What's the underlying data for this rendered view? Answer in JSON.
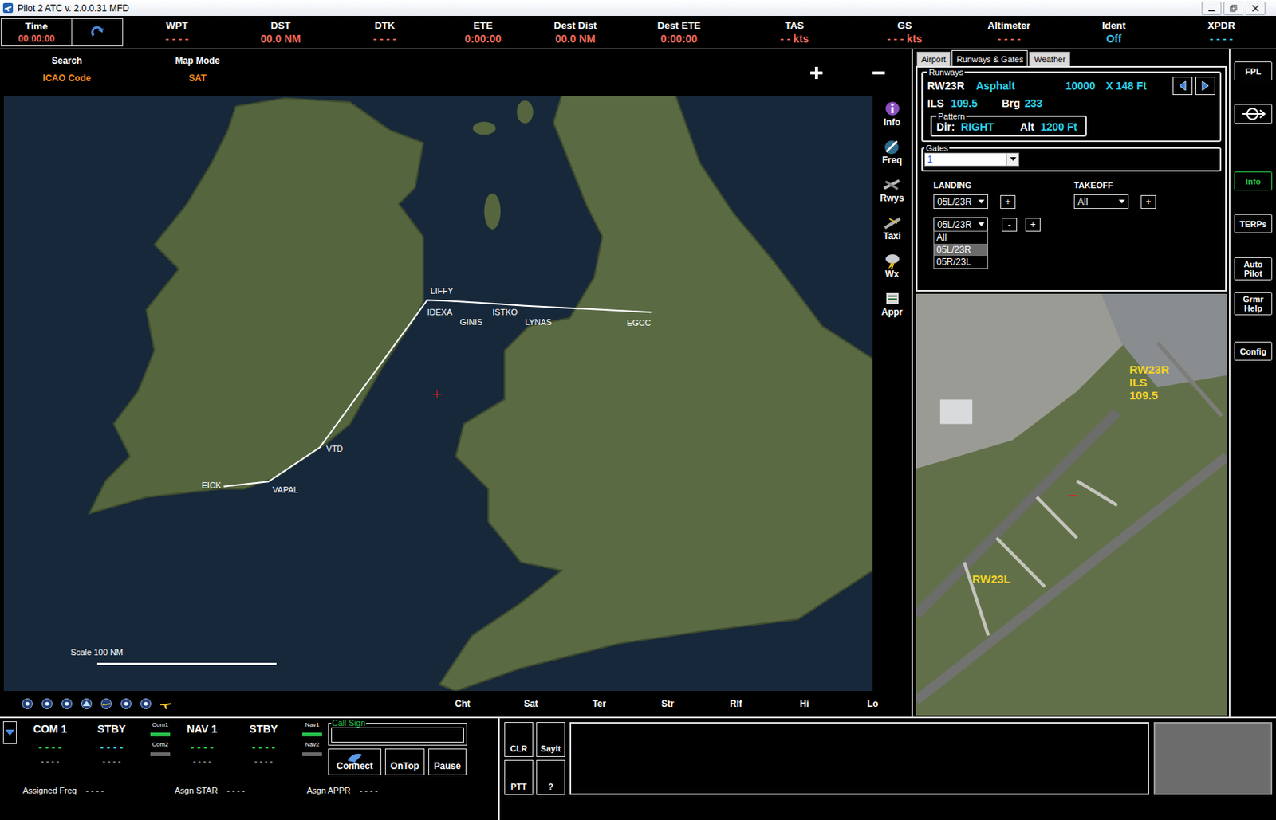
{
  "window": {
    "title": "Pilot 2 ATC v. 2.0.0.31 MFD"
  },
  "time": {
    "label": "Time",
    "value": "00:00:00"
  },
  "readouts": [
    {
      "label": "WPT",
      "value": "- - - -",
      "color": "#f26b5b"
    },
    {
      "label": "DST",
      "value": "00.0 NM",
      "color": "#f26b5b"
    },
    {
      "label": "DTK",
      "value": "- - - -",
      "color": "#f26b5b"
    },
    {
      "label": "ETE",
      "value": "0:00:00",
      "color": "#f26b5b"
    },
    {
      "label": "Dest Dist",
      "value": "00.0 NM",
      "color": "#f26b5b"
    },
    {
      "label": "Dest ETE",
      "value": "0:00:00",
      "color": "#f26b5b"
    },
    {
      "label": "TAS",
      "value": "- - kts",
      "color": "#f26b5b"
    },
    {
      "label": "GS",
      "value": "- - - kts",
      "color": "#f26b5b"
    },
    {
      "label": "Altimeter",
      "value": "- - - -",
      "color": "#f26b5b"
    },
    {
      "label": "Ident",
      "value": "Off",
      "color": "#3cc4e8"
    },
    {
      "label": "XPDR",
      "value": "- - - -",
      "color": "#3cc4e8"
    }
  ],
  "map": {
    "search": {
      "label": "Search",
      "value": "ICAO Code"
    },
    "mode": {
      "label": "Map Mode",
      "value": "SAT"
    },
    "tools": [
      "Info",
      "Freq",
      "Rwys",
      "Taxi",
      "Wx",
      "Appr"
    ],
    "route": [
      "EICK",
      "VAPAL",
      "VTD",
      "LIFFY",
      "IDEXA",
      "GINIS",
      "ISTKO",
      "LYNAS",
      "EGCC"
    ],
    "scale": "Scale 100 NM",
    "layers": [
      "Cht",
      "Sat",
      "Ter",
      "Str",
      "Rlf",
      "Hi",
      "Lo"
    ]
  },
  "airport_panel": {
    "tabs": [
      {
        "label": "Airport",
        "selected": false
      },
      {
        "label": "Runways & Gates",
        "selected": true
      },
      {
        "label": "Weather",
        "selected": false
      }
    ],
    "runways": {
      "legend": "Runways",
      "name": "RW23R",
      "surface": "Asphalt",
      "length": "10000",
      "width": "X 148 Ft",
      "ils_label": "ILS",
      "ils": "109.5",
      "brg_label": "Brg",
      "brg": "233",
      "pattern": {
        "legend": "Pattern",
        "dir_label": "Dir:",
        "dir": "RIGHT",
        "alt_label": "Alt",
        "alt": "1200 Ft"
      }
    },
    "gates": {
      "legend": "Gates",
      "value": "1"
    },
    "landing": {
      "label": "LANDING",
      "selects": [
        {
          "value": "05L/23R",
          "open": false,
          "options": []
        },
        {
          "value": "05L/23R",
          "open": true,
          "options": [
            {
              "label": "All",
              "selected": false
            },
            {
              "label": "05L/23R",
              "selected": true
            },
            {
              "label": "05R/23L",
              "selected": false
            }
          ]
        }
      ],
      "buttons": [
        [
          "+"
        ],
        [
          "-",
          "+"
        ]
      ]
    },
    "takeoff": {
      "label": "TAKEOFF",
      "value": "All",
      "button": "+"
    },
    "photo_labels": [
      {
        "lines": [
          "RW23R",
          "ILS",
          "109.5"
        ]
      },
      {
        "lines": [
          "RW23L"
        ]
      }
    ]
  },
  "side_buttons": [
    {
      "label": "FPL",
      "kind": "text",
      "selected": false
    },
    {
      "kind": "icon",
      "selected": false
    },
    {
      "label": "Info",
      "kind": "text",
      "selected": true
    },
    {
      "label": "TERPs",
      "kind": "text",
      "selected": false
    },
    {
      "label": "Auto Pilot",
      "kind": "text",
      "selected": false
    },
    {
      "label": "Grmr Help",
      "kind": "text",
      "selected": false
    },
    {
      "label": "Config",
      "kind": "text",
      "selected": false
    }
  ],
  "radio": {
    "groups": [
      {
        "radios": [
          {
            "label": "COM 1",
            "value": "- - - -",
            "sub": "- - - -",
            "color": "#2ecc40"
          },
          {
            "label": "STBY",
            "value": "- - - -",
            "sub": "- - - -",
            "color": "#3cc4e8"
          }
        ],
        "indicators": [
          {
            "label": "Com1",
            "on": true
          },
          {
            "label": "Com2",
            "on": false
          }
        ]
      },
      {
        "radios": [
          {
            "label": "NAV 1",
            "value": "- - - -",
            "sub": "- - - -",
            "color": "#2ecc40"
          },
          {
            "label": "STBY",
            "value": "- - - -",
            "sub": "- - - -",
            "color": "#2ecc40"
          }
        ],
        "indicators": [
          {
            "label": "Nav1",
            "on": true
          },
          {
            "label": "Nav2",
            "on": false
          }
        ]
      }
    ],
    "call_sign": {
      "legend": "Call Sign",
      "value": ""
    },
    "buttons": [
      "Connect",
      "OnTop",
      "Pause"
    ],
    "assigned": [
      {
        "label": "Assigned Freq",
        "value": "- - - -"
      },
      {
        "label": "Asgn STAR",
        "value": "- - - -"
      },
      {
        "label": "Asgn APPR",
        "value": "- - - -"
      }
    ]
  },
  "message": {
    "buttons": [
      "CLR",
      "SayIt",
      "PTT",
      "?"
    ],
    "text": ""
  }
}
